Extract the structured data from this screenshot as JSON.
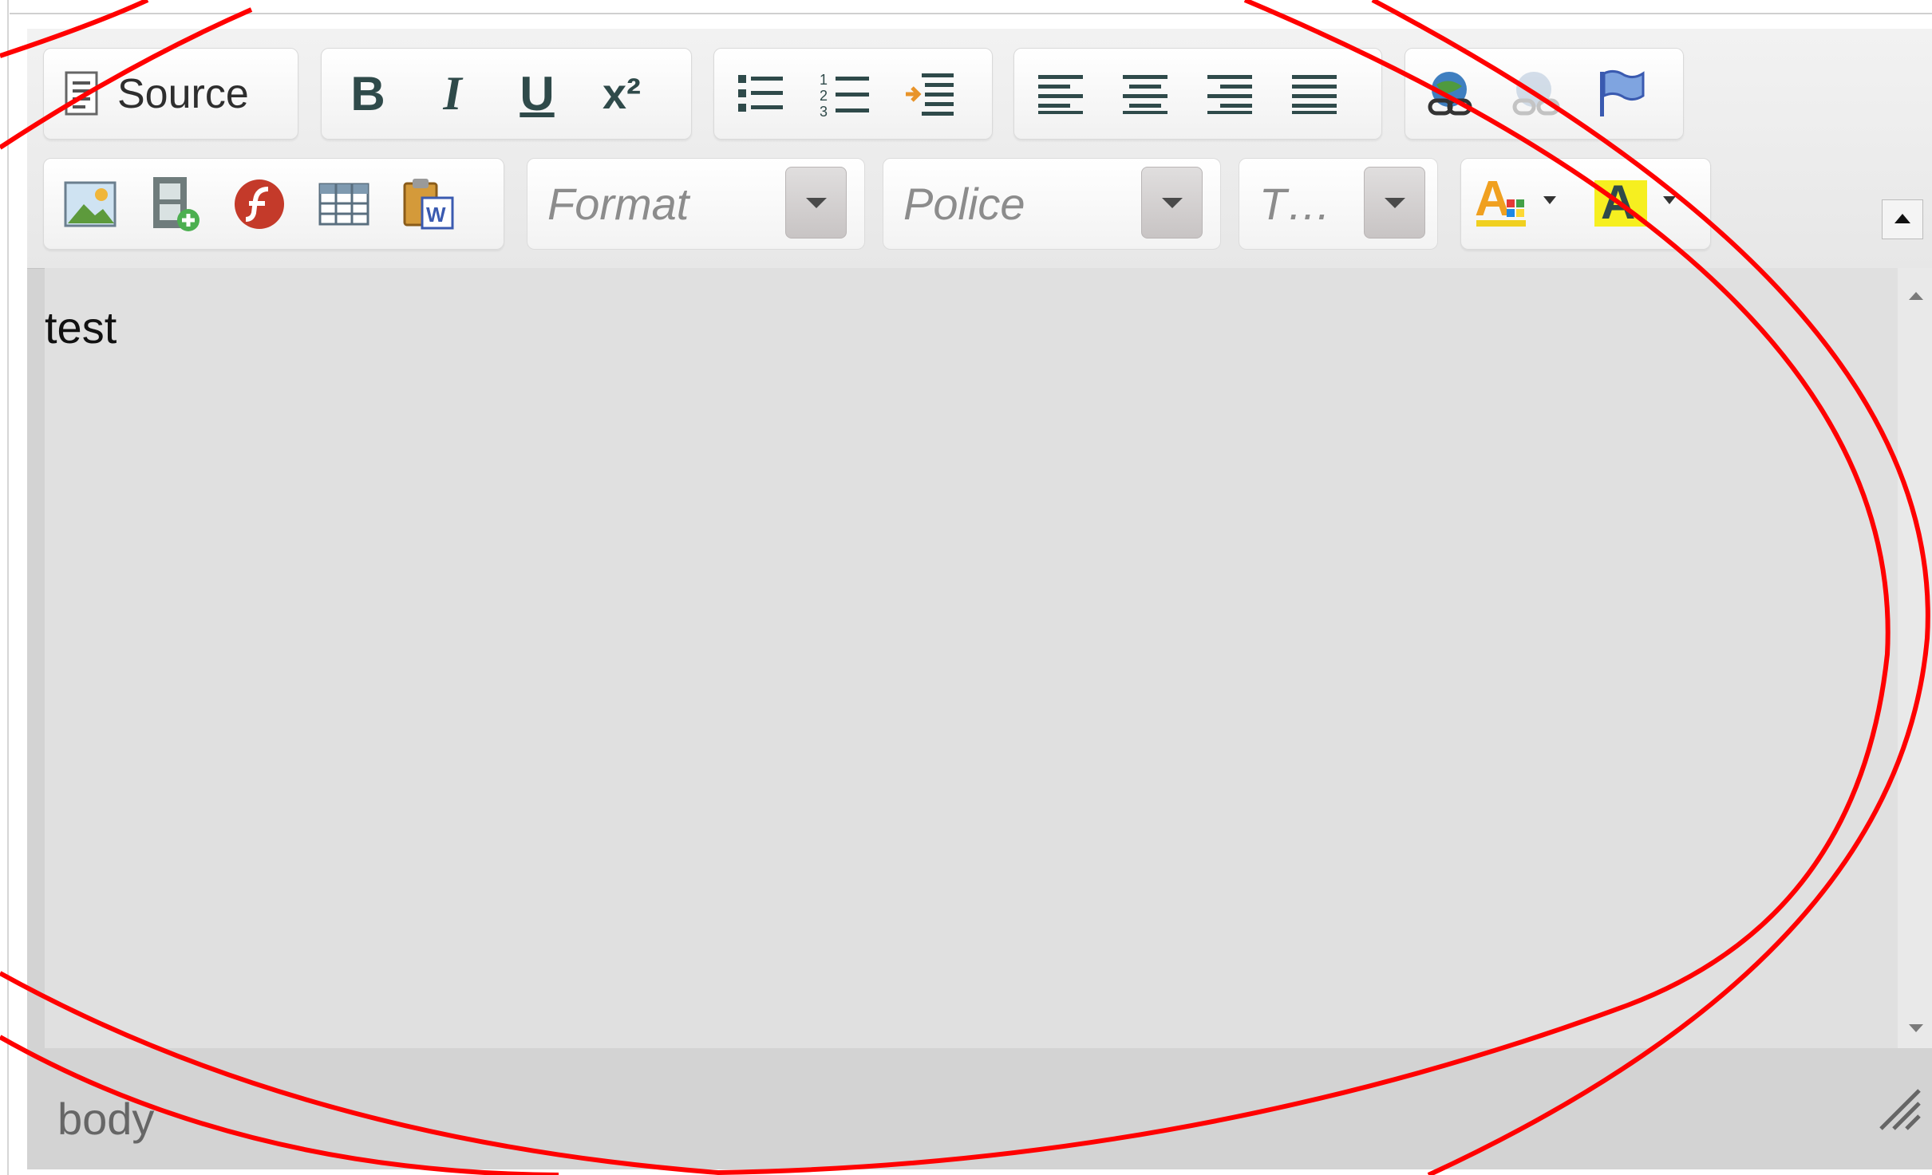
{
  "toolbar": {
    "source_label": "Source",
    "bold_label": "B",
    "italic_label": "I",
    "underline_label": "U",
    "superscript_label": "x²",
    "format_placeholder": "Format",
    "font_placeholder": "Police",
    "size_placeholder": "T…"
  },
  "content": {
    "text": "test"
  },
  "statusbar": {
    "path": "body"
  },
  "colors": {
    "annotation": "#ff0000",
    "content_bg": "#e0e0e0",
    "toolbar_bg": "#eeeeee",
    "icon_teal": "#2f4a4a"
  },
  "icons": [
    "source-icon",
    "bullet-list-icon",
    "numbered-list-icon",
    "indent-icon",
    "align-left-icon",
    "align-center-icon",
    "align-right-icon",
    "align-justify-icon",
    "link-icon",
    "unlink-icon",
    "anchor-flag-icon",
    "image-icon",
    "video-icon",
    "flash-icon",
    "table-icon",
    "paste-word-icon",
    "text-color-icon",
    "background-color-icon",
    "resize-grip-icon"
  ]
}
